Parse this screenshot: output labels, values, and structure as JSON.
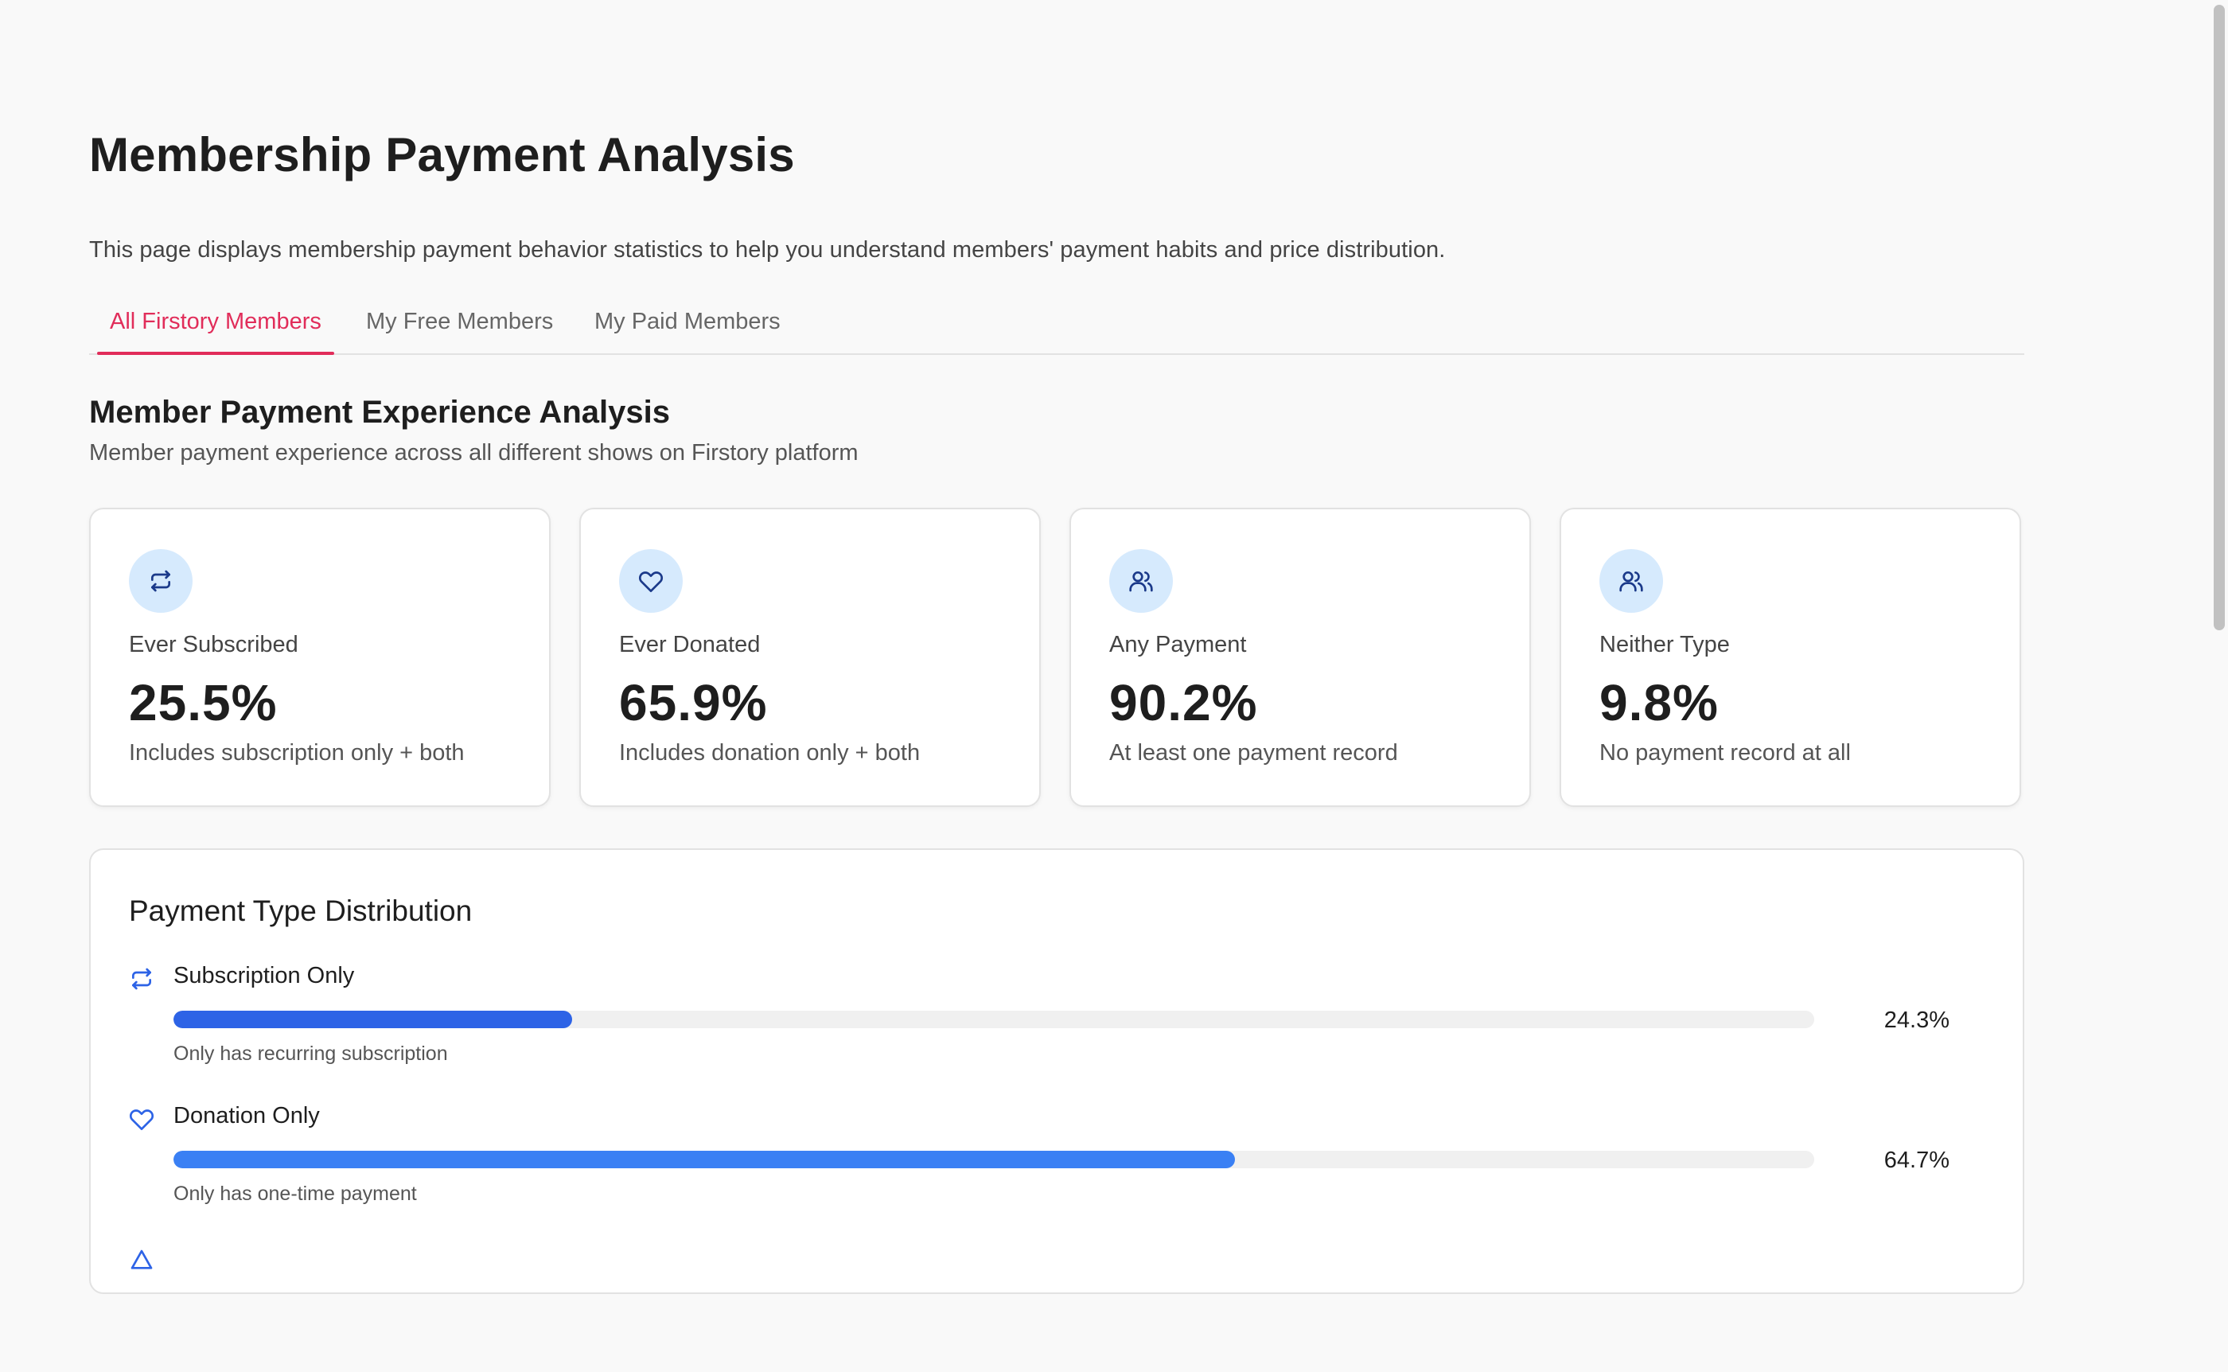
{
  "page": {
    "title": "Membership Payment Analysis",
    "description": "This page displays membership payment behavior statistics to help you understand members' payment habits and price distribution."
  },
  "tabs": [
    {
      "label": "All Firstory Members",
      "active": true
    },
    {
      "label": "My Free Members",
      "active": false
    },
    {
      "label": "My Paid Members",
      "active": false
    }
  ],
  "section": {
    "title": "Member Payment Experience Analysis",
    "subtitle": "Member payment experience across all different shows on Firstory platform"
  },
  "stat_cards": [
    {
      "icon": "repeat-icon",
      "label": "Ever Subscribed",
      "value": "25.5%",
      "note": "Includes subscription only + both"
    },
    {
      "icon": "heart-icon",
      "label": "Ever Donated",
      "value": "65.9%",
      "note": "Includes donation only + both"
    },
    {
      "icon": "users-icon",
      "label": "Any Payment",
      "value": "90.2%",
      "note": "At least one payment record"
    },
    {
      "icon": "users-icon",
      "label": "Neither Type",
      "value": "9.8%",
      "note": "No payment record at all"
    }
  ],
  "distribution": {
    "title": "Payment Type Distribution",
    "rows": [
      {
        "icon": "repeat-icon",
        "label": "Subscription Only",
        "value_text": "24.3%",
        "fraction": 0.243,
        "color": "#2d63e6",
        "note": "Only has recurring subscription"
      },
      {
        "icon": "heart-icon",
        "label": "Donation Only",
        "value_text": "64.7%",
        "fraction": 0.647,
        "color": "#3a80f4",
        "note": "Only has one-time payment"
      }
    ]
  },
  "colors": {
    "accent": "#e12d5a",
    "icon_bg": "#d6eafd",
    "icon_stroke": "#1b3a8a",
    "row_icon": "#2d63e6"
  }
}
